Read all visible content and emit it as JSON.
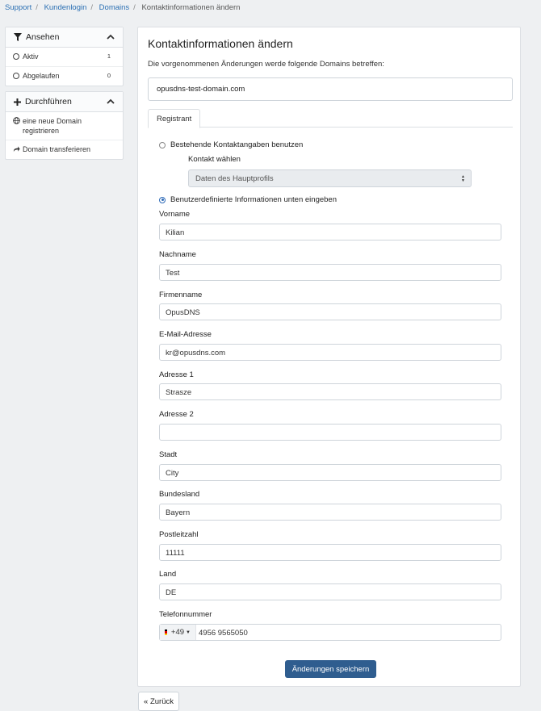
{
  "breadcrumb": [
    "Support",
    "Kundenlogin",
    "Domains",
    "Kontaktinformationen ändern"
  ],
  "panels": {
    "view": {
      "title": "Ansehen",
      "items": [
        {
          "label": "Aktiv",
          "count": "1"
        },
        {
          "label": "Abgelaufen",
          "count": "0"
        }
      ]
    },
    "actions": {
      "title": "Durchführen",
      "items": [
        {
          "label": "eine neue Domain registrieren"
        },
        {
          "label": "Domain transferieren"
        }
      ]
    }
  },
  "main": {
    "title": "Kontaktinformationen ändern",
    "intro": "Die vorgenommenen Änderungen werde folgende Domains betreffen:",
    "domain": "opusdns-test-domain.com",
    "tab": "Registrant",
    "option_existing": "Bestehende Kontaktangaben benutzen",
    "contact_label": "Kontakt wählen",
    "contact_select": "Daten des Hauptprofils",
    "option_custom": "Benutzerdefinierte Informationen unten eingeben",
    "fields": {
      "firstname": {
        "label": "Vorname",
        "value": "Kilian"
      },
      "lastname": {
        "label": "Nachname",
        "value": "Test"
      },
      "company": {
        "label": "Firmenname",
        "value": "OpusDNS"
      },
      "email": {
        "label": "E-Mail-Adresse",
        "value": "kr@opusdns.com"
      },
      "address1": {
        "label": "Adresse 1",
        "value": "Strasze"
      },
      "address2": {
        "label": "Adresse 2",
        "value": ""
      },
      "city": {
        "label": "Stadt",
        "value": "City"
      },
      "state": {
        "label": "Bundesland",
        "value": "Bayern"
      },
      "postcode": {
        "label": "Postleitzahl",
        "value": "11111"
      },
      "country": {
        "label": "Land",
        "value": "DE"
      },
      "phone": {
        "label": "Telefonnummer",
        "prefix": "+49",
        "value": "4956 9565050"
      }
    },
    "save_label": "Änderungen speichern"
  },
  "back_label": "« Zurück",
  "colors": {
    "primary": "#2f5d8f",
    "link": "#2a6fb3",
    "radio": "#2f6bb8"
  }
}
